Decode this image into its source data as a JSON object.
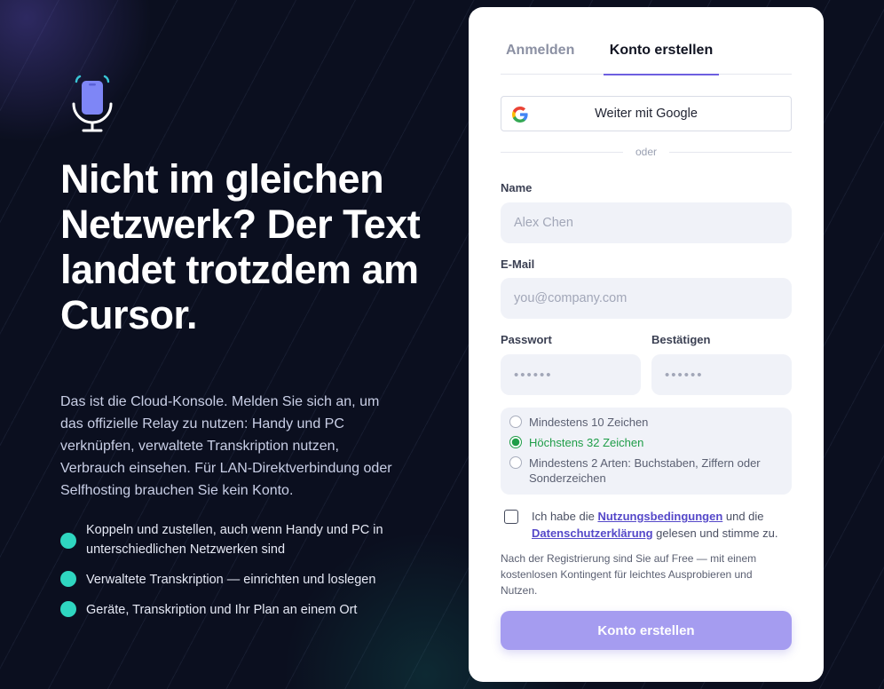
{
  "hero": {
    "headline": "Nicht im gleichen Netzwerk? Der Text landet trotzdem am Cursor.",
    "description": "Das ist die Cloud-Konsole. Melden Sie sich an, um das offizielle Relay zu nutzen: Handy und PC verknüpfen, verwaltete Transkription nutzen, Verbrauch einsehen. Für LAN-Direktverbindung oder Selfhosting brauchen Sie kein Konto.",
    "features": [
      "Koppeln und zustellen, auch wenn Handy und PC in unterschiedlichen Netzwerken sind",
      "Verwaltete Transkription — einrichten und loslegen",
      "Geräte, Transkription und Ihr Plan an einem Ort"
    ],
    "logo_icon": "phone-microphone-icon"
  },
  "auth": {
    "tabs": {
      "login": "Anmelden",
      "create": "Konto erstellen"
    },
    "google_button": "Weiter mit Google",
    "divider": "oder",
    "name": {
      "label": "Name",
      "placeholder": "Alex Chen"
    },
    "email": {
      "label": "E-Mail",
      "placeholder": "you@company.com"
    },
    "password": {
      "label": "Passwort",
      "placeholder": "••••••"
    },
    "confirm": {
      "label": "Bestätigen",
      "placeholder": "••••••"
    },
    "rules": [
      {
        "text": "Mindestens 10 Zeichen",
        "met": false
      },
      {
        "text": "Höchstens 32 Zeichen",
        "met": true
      },
      {
        "text": "Mindestens 2 Arten: Buchstaben, Ziffern oder Sonderzeichen",
        "met": false
      }
    ],
    "consent": {
      "before": "Ich habe die ",
      "terms": "Nutzungsbedingungen",
      "middle": " und die ",
      "privacy": "Datenschutzerklärung",
      "after": " gelesen und stimme zu."
    },
    "note": "Nach der Registrierung sind Sie auf Free — mit einem kostenlosen Kontingent für leichtes Ausprobieren und Nutzen.",
    "submit": "Konto erstellen"
  },
  "colors": {
    "background": "#0b0f1f",
    "accent": "#6d5fe0",
    "feature_dot": "#2fd6c0",
    "rule_ok": "#1f9d48",
    "submit": "#a59cf0"
  }
}
